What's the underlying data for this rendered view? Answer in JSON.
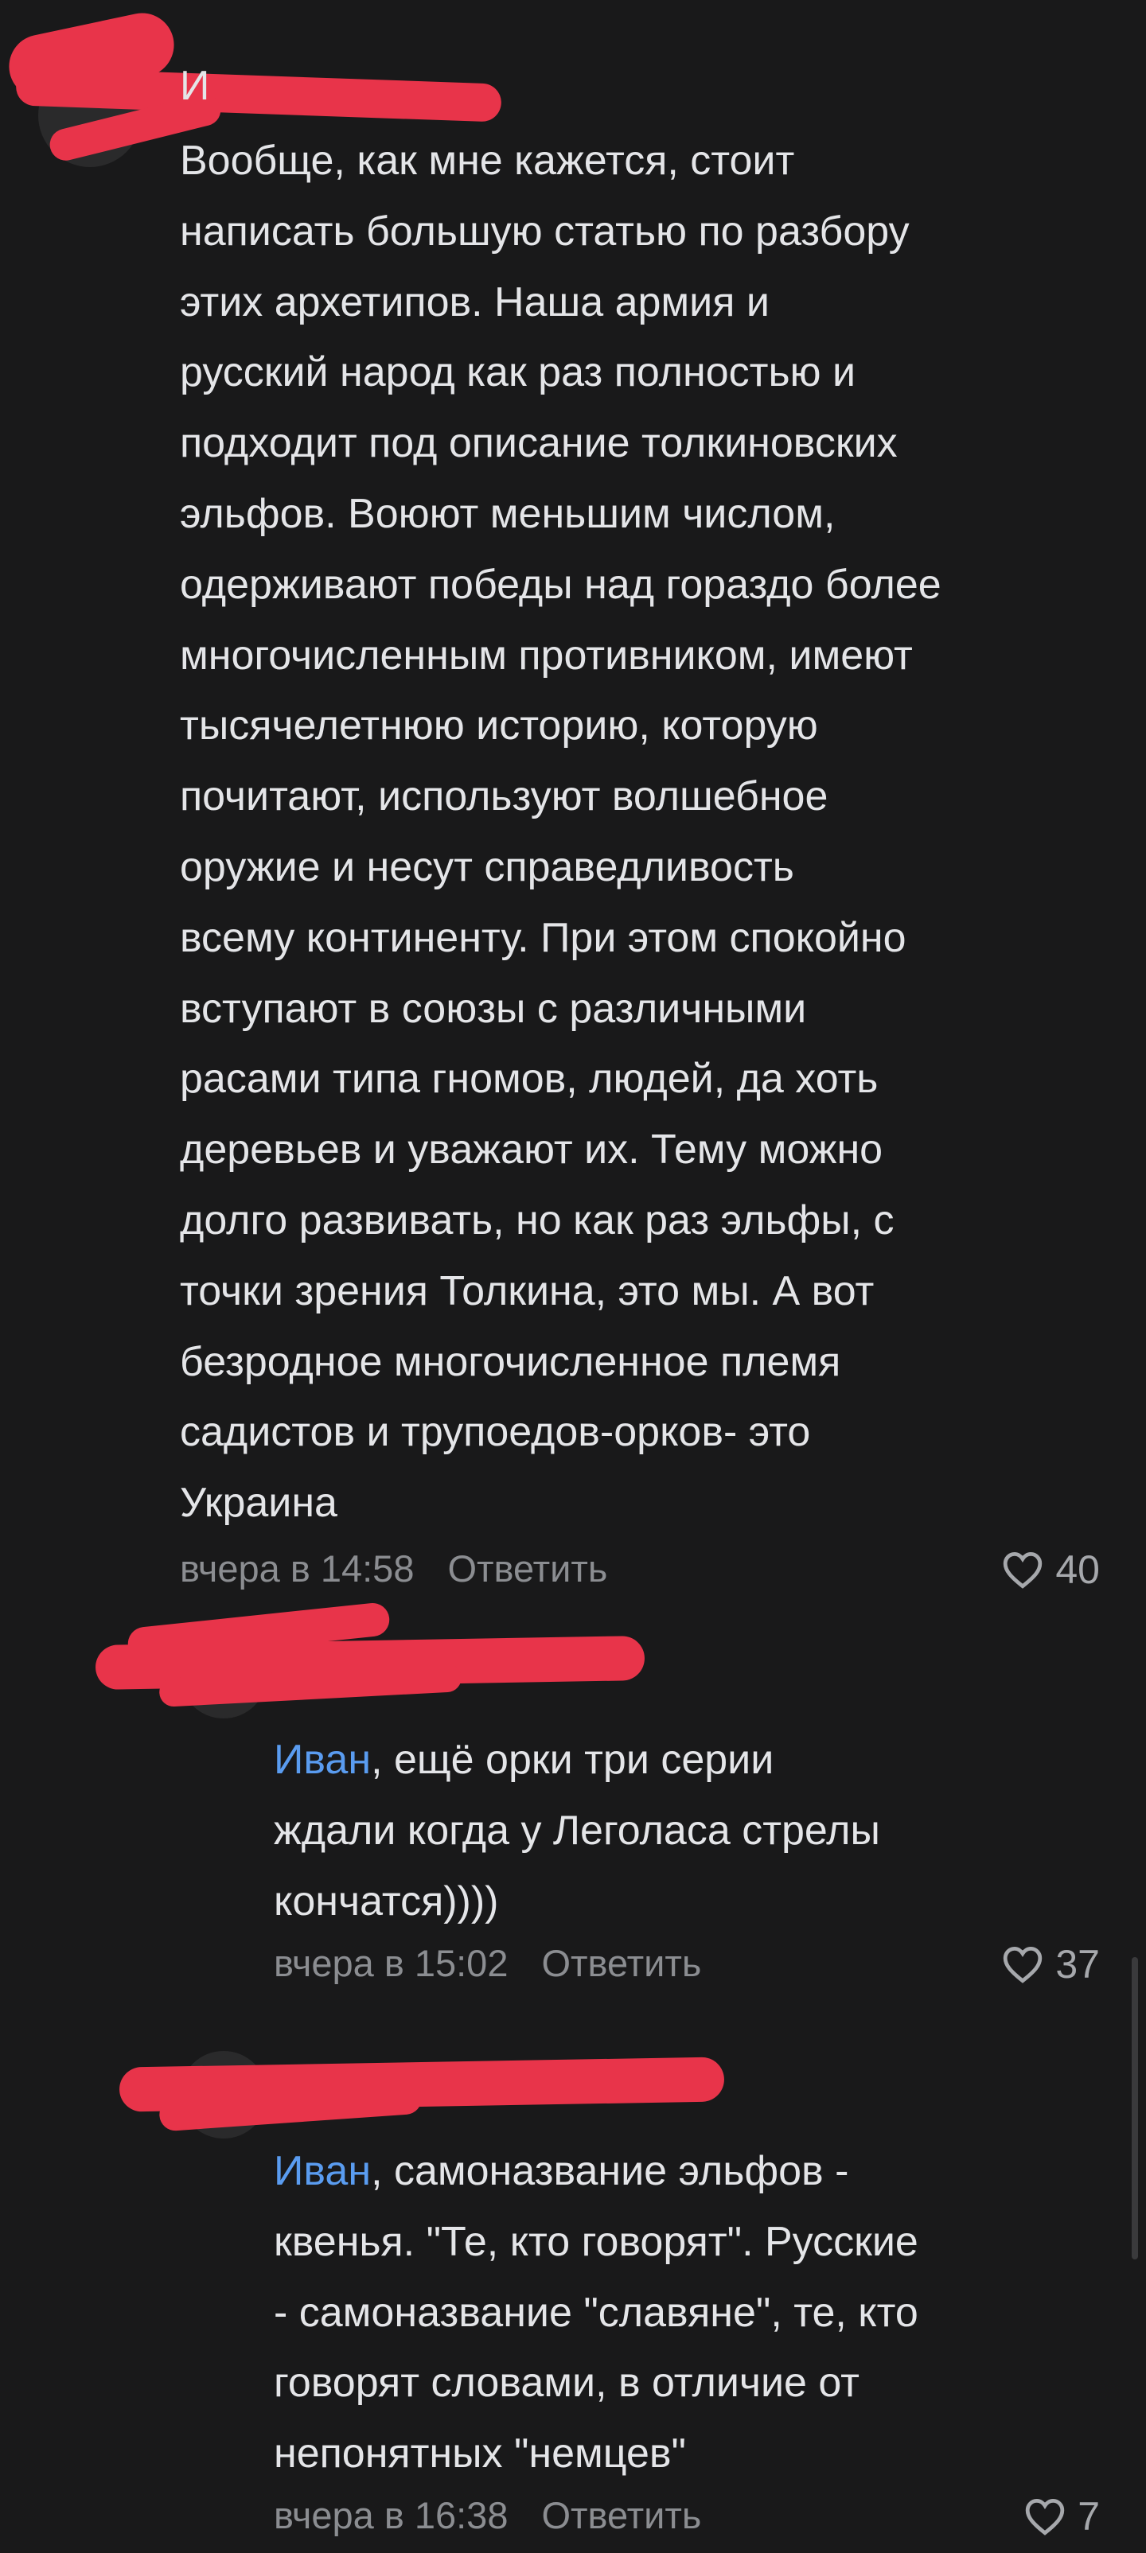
{
  "comments": [
    {
      "author": "И",
      "text": "Вообще, как мне кажется, стоит\nнаписать большую статью по разбору\nэтих архетипов. Наша армия и\nрусский народ как раз полностью и\nподходит под описание толкиновских\nэльфов. Воюют меньшим числом,\nодерживают победы над гораздо более\nмногочисленным противником, имеют\nтысячелетнюю историю, которую\nпочитают, используют волшебное\nоружие и несут справедливость\nвсему континенту. При этом спокойно\nвступают в союзы с различными\nрасами типа гномов, людей, да хоть\nдеревьев и уважают их. Тему можно\nдолго развивать, но как раз эльфы, с\nточки зрения Толкина, это мы. А вот\nбезродное многочисленное племя\nсадистов и трупоедов-орков- это\nУкраина",
      "time": "вчера в 14:58",
      "reply_label": "Ответить",
      "likes": "40"
    },
    {
      "mention": "Иван",
      "text": ", ещё орки три серии\nждали когда у Леголаса стрелы\nкончатся))))",
      "time": "вчера в 15:02",
      "reply_label": "Ответить",
      "likes": "37"
    },
    {
      "mention": "Иван",
      "text": ", самоназвание эльфов -\nквенья. \"Те, кто говорят\". Русские\n- самоназвание \"славяне\", те, кто\nговорят словами, в отличие от\nнепонятных \"немцев\"",
      "time": "вчера в 16:38",
      "reply_label": "Ответить",
      "likes": "7"
    }
  ],
  "colors": {
    "background": "#19191a",
    "text": "#e4e5e8",
    "mention": "#5a9cf0",
    "meta": "#8b8d91",
    "redaction": "#e8344a"
  }
}
